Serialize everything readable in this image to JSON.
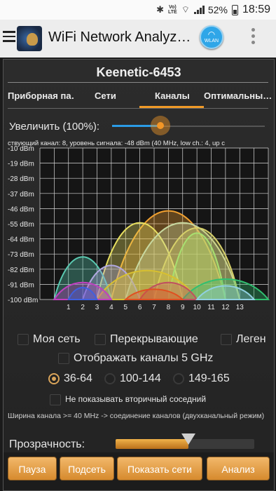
{
  "status_bar": {
    "battery": "52%",
    "time": "18:59",
    "lte_top": "Vo)",
    "lte_bottom": "LTE"
  },
  "app_bar": {
    "title": "WiFi Network Analyz…",
    "wlan_label": "WLAN"
  },
  "network_name": "Keenetic-6453",
  "tabs": [
    {
      "label": "Приборная па…",
      "active": false
    },
    {
      "label": "Сети",
      "active": false
    },
    {
      "label": "Каналы",
      "active": true
    },
    {
      "label": "Оптимальны…",
      "active": false
    }
  ],
  "zoom": {
    "label": "Увеличить (100%):",
    "level_fraction": 0.33
  },
  "chart_data": {
    "type": "area",
    "info_line": "ствующий канал: 8, уровень сигнала: -48 dBm (40 MHz, low ch.: 4, up c",
    "y_tick_labels": [
      "-10 dBm",
      "-19 dBm",
      "-28 dBm",
      "-37 dBm",
      "-46 dBm",
      "-55 dBm",
      "-64 dBm",
      "-73 dBm",
      "-82 dBm",
      "-91 dBm",
      "-100 dBm"
    ],
    "y_range": [
      -100,
      -10
    ],
    "x_tick_labels": [
      "1",
      "2",
      "3",
      "4",
      "5",
      "6",
      "7",
      "8",
      "9",
      "10",
      "11",
      "12",
      "13"
    ],
    "x_range": [
      -1,
      15
    ],
    "grid": true,
    "series": [
      {
        "low": 4,
        "high": 12,
        "peak": -48,
        "color": "#f0a030"
      },
      {
        "low": 3,
        "high": 9,
        "peak": -55,
        "color": "#e8e060"
      },
      {
        "low": 5,
        "high": 13,
        "peak": -55,
        "color": "#c8d8a0"
      },
      {
        "low": 7,
        "high": 13,
        "peak": -58,
        "color": "#d6d06a"
      },
      {
        "low": 8,
        "high": 12,
        "peak": -61,
        "color": "#a8e070"
      },
      {
        "low": 0,
        "high": 4,
        "peak": -75,
        "color": "#5ac8b0"
      },
      {
        "low": 2,
        "high": 6,
        "peak": -80,
        "color": "#b0a8e0"
      },
      {
        "low": 3,
        "high": 10,
        "peak": -83,
        "color": "#d8c030"
      },
      {
        "low": 9,
        "high": 15,
        "peak": -88,
        "color": "#30c070"
      },
      {
        "low": 6,
        "high": 10,
        "peak": -90,
        "color": "#c05060"
      },
      {
        "low": 0,
        "high": 4,
        "peak": -90,
        "color": "#c040c0"
      },
      {
        "low": 1,
        "high": 3,
        "peak": -93,
        "color": "#4060e0"
      },
      {
        "low": 5,
        "high": 9,
        "peak": -94,
        "color": "#e05020"
      },
      {
        "low": 10,
        "high": 14,
        "peak": -92,
        "color": "#90d0e0"
      }
    ]
  },
  "filters": {
    "my_network": "Моя сеть",
    "overlapping": "Перекрывающие",
    "legend": "Леген",
    "show_5ghz": "Отображать каналы 5 GHz",
    "bands": [
      "36-64",
      "100-144",
      "149-165"
    ],
    "selected_band": "36-64",
    "no_secondary": "Не показывать вторичный соседний"
  },
  "note": "Ширина канала >= 40 MHz -> соединение каналов (двухканальный режим)",
  "transparency": {
    "label": "Прозрачность:",
    "level_fraction": 0.55
  },
  "buttons": {
    "pause": "Пауза",
    "subnet": "Подсеть",
    "show_networks": "Показать сети",
    "analysis": "Анализ"
  }
}
